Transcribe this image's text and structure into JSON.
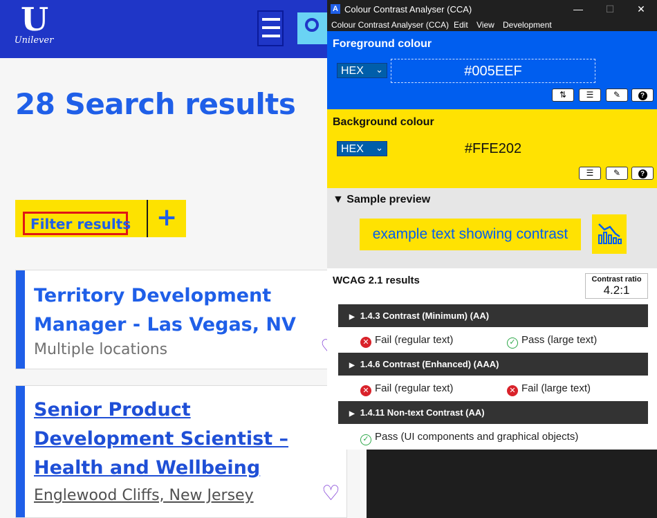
{
  "site": {
    "logo_text": "Unilever",
    "results_title": "28 Search results",
    "filter_label": "Filter results",
    "filter_add": "+",
    "jobs": [
      {
        "title_line1": "Territory Development",
        "title_line2": "Manager - Las Vegas, NV",
        "location": "Multiple locations"
      },
      {
        "title_line1": "Senior Product",
        "title_line2": "Development Scientist –",
        "title_line3": "Health and Wellbeing",
        "location": "Englewood Cliffs, New Jersey"
      }
    ]
  },
  "cca": {
    "window_title": "Colour Contrast Analyser (CCA)",
    "menu": [
      "Colour Contrast Analyser (CCA)",
      "Edit",
      "View",
      "Development"
    ],
    "foreground": {
      "title": "Foreground colour",
      "format": "HEX",
      "value": "#005EEF",
      "color": "#005eef"
    },
    "background": {
      "title": "Background colour",
      "format": "HEX",
      "value": "#FFE202",
      "color": "#ffe202"
    },
    "preview": {
      "title": "Sample preview",
      "text": "example text showing contrast"
    },
    "wcag": {
      "title": "WCAG 2.1 results",
      "ratio_label": "Contrast ratio",
      "ratio_value": "4.2:1",
      "criteria": [
        {
          "label": "1.4.3 Contrast (Minimum) (AA)",
          "results": [
            {
              "status": "fail",
              "text": "Fail (regular text)"
            },
            {
              "status": "pass",
              "text": "Pass (large text)"
            }
          ]
        },
        {
          "label": "1.4.6 Contrast (Enhanced) (AAA)",
          "results": [
            {
              "status": "fail",
              "text": "Fail (regular text)"
            },
            {
              "status": "fail",
              "text": "Fail (large text)"
            }
          ]
        },
        {
          "label": "1.4.11 Non-text Contrast (AA)",
          "results": [
            {
              "status": "pass",
              "text": "Pass (UI components and graphical objects)"
            }
          ]
        }
      ]
    }
  }
}
